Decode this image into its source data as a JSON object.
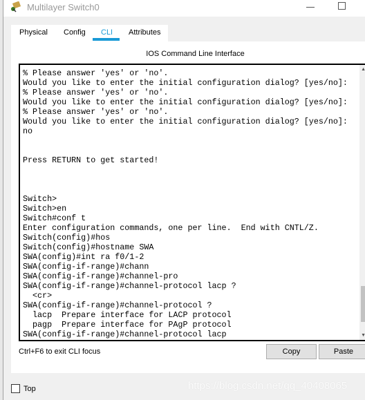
{
  "window": {
    "title": "Multilayer Switch0",
    "icon": "router-icon"
  },
  "tabs": [
    {
      "label": "Physical",
      "active": false
    },
    {
      "label": "Config",
      "active": false
    },
    {
      "label": "CLI",
      "active": true
    },
    {
      "label": "Attributes",
      "active": false
    }
  ],
  "accent_color": "#1a9ad6",
  "cli": {
    "heading": "IOS Command Line Interface",
    "lines": [
      "% Please answer 'yes' or 'no'.",
      "Would you like to enter the initial configuration dialog? [yes/no]:",
      "% Please answer 'yes' or 'no'.",
      "Would you like to enter the initial configuration dialog? [yes/no]:",
      "% Please answer 'yes' or 'no'.",
      "Would you like to enter the initial configuration dialog? [yes/no]:",
      "no",
      "",
      "",
      "Press RETURN to get started!",
      "",
      "",
      "",
      "Switch>",
      "Switch>en",
      "Switch#conf t",
      "Enter configuration commands, one per line.  End with CNTL/Z.",
      "Switch(config)#hos",
      "Switch(config)#hostname SWA",
      "SWA(config)#int ra f0/1-2",
      "SWA(config-if-range)#chann",
      "SWA(config-if-range)#channel-pro",
      "SWA(config-if-range)#channel-protocol lacp ?",
      "  <cr>",
      "SWA(config-if-range)#channel-protocol ?",
      "  lacp  Prepare interface for LACP protocol",
      "  pagp  Prepare interface for PAgP protocol",
      "SWA(config-if-range)#channel-protocol lacp"
    ],
    "hint": "Ctrl+F6 to exit CLI focus",
    "copy_label": "Copy",
    "paste_label": "Paste"
  },
  "footer": {
    "top_label": "Top",
    "top_checked": false
  },
  "watermark": "https://blog.csdn.net/qq_40408065"
}
